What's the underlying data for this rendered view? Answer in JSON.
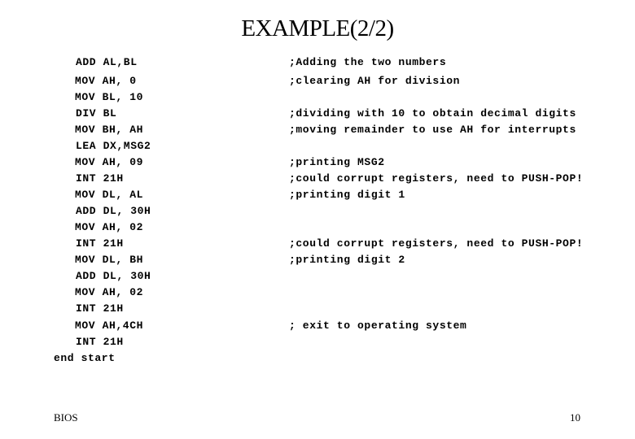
{
  "slide": {
    "title": "EXAMPLE(2/2)",
    "code_lines": [
      "ADD AL,BL",
      "MOV AH, 0",
      "MOV BL, 10",
      "DIV BL",
      "MOV BH, AH",
      "LEA DX,MSG2",
      "MOV AH, 09",
      "INT 21H",
      "MOV DL, AL",
      "ADD DL, 30H",
      "MOV AH, 02",
      "INT 21H",
      "MOV DL, BH",
      "ADD DL, 30H",
      "MOV AH, 02",
      "INT 21H",
      "MOV AH,4CH",
      "INT 21H",
      "end start"
    ],
    "comments": [
      ";Adding the two numbers",
      ";clearing AH for division",
      ";dividing with 10 to obtain decimal digits",
      ";moving remainder to use AH for interrupts",
      ";printing MSG2",
      ";could corrupt registers, need to PUSH-POP!",
      ";printing digit 1",
      ";could corrupt registers, need to PUSH-POP!",
      ";printing digit 2",
      "; exit to operating system"
    ],
    "footer": {
      "left": "BIOS",
      "page_number": "10"
    }
  }
}
